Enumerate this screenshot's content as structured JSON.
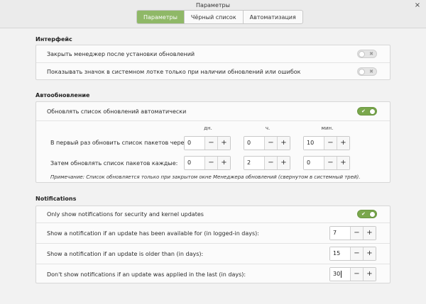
{
  "window": {
    "title": "Параметры"
  },
  "tabs": [
    {
      "label": "Параметры",
      "active": true
    },
    {
      "label": "Чёрный список",
      "active": false
    },
    {
      "label": "Автоматизация",
      "active": false
    }
  ],
  "interface": {
    "title": "Интерфейс",
    "rows": [
      {
        "label": "Закрыть менеджер после установки обновлений",
        "enabled": false
      },
      {
        "label": "Показывать значок в системном лотке только при наличии обновлений или ошибок",
        "enabled": false
      }
    ]
  },
  "autoupdate": {
    "title": "Автообновление",
    "toggle_label": "Обновлять список обновлений автоматически",
    "toggle_enabled": true,
    "columns": [
      "дн.",
      "ч.",
      "мин."
    ],
    "first_refresh": {
      "label": "В первый раз обновить список пакетов через:",
      "values": [
        "0",
        "0",
        "10"
      ]
    },
    "then_refresh": {
      "label": "Затем обновлять список пакетов каждые:",
      "values": [
        "0",
        "2",
        "0"
      ]
    },
    "note": "Примечание: Список обновляется только при закрытом окне Менеджера обновлений (свернутом в системный трей)."
  },
  "notifications": {
    "title": "Notifications",
    "toggle_label": "Only show notifications for security and kernel updates",
    "toggle_enabled": true,
    "rows": [
      {
        "label": "Show a notification if an update has been available for (in logged-in days):",
        "value": "7"
      },
      {
        "label": "Show a notification if an update is older than (in days):",
        "value": "15"
      },
      {
        "label": "Don't show notifications if an update was applied in the last (in days):",
        "value": "30"
      }
    ]
  },
  "glyphs": {
    "minus": "−",
    "plus": "+",
    "close": "×",
    "check": "✔",
    "cross": "✖"
  },
  "colors": {
    "accent": "#8fb867",
    "switch_on": "#7aa74c"
  }
}
